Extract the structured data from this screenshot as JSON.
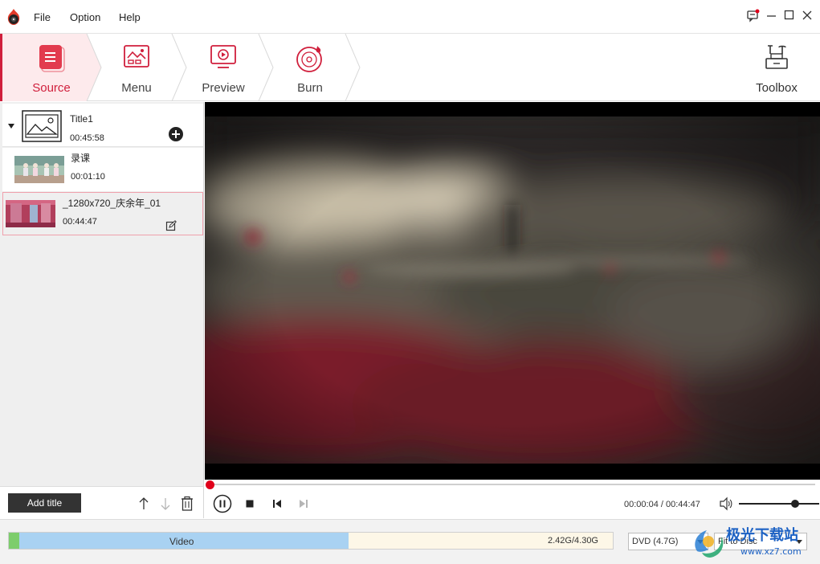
{
  "menu": {
    "file": "File",
    "option": "Option",
    "help": "Help"
  },
  "steps": [
    {
      "label": "Source",
      "active": true
    },
    {
      "label": "Menu",
      "active": false
    },
    {
      "label": "Preview",
      "active": false
    },
    {
      "label": "Burn",
      "active": false
    }
  ],
  "toolbox": {
    "label": "Toolbox"
  },
  "title": {
    "name": "Title1",
    "duration": "00:45:58"
  },
  "clips": [
    {
      "name": "录课",
      "duration": "00:01:10"
    },
    {
      "name": "_1280x720_庆余年_01",
      "duration": "00:44:47"
    }
  ],
  "left_bottom": {
    "add_title": "Add title"
  },
  "player": {
    "time": "00:00:04 / 00:44:47",
    "progress_fraction": 0.0015,
    "volume_fraction": 0.7
  },
  "status": {
    "capacity_label": "Video",
    "capacity_size": "2.42G/4.30G",
    "used_fraction": 0.563,
    "disc_type": "DVD (4.7G)",
    "fit_mode": "Fit to Disc"
  },
  "watermark": {
    "text": "极光下载站",
    "url": "www.xz7.com"
  },
  "colors": {
    "accent": "#d01f3c",
    "capacity": "#a9d2f2"
  },
  "icons": [
    "app-logo-icon",
    "source-icon",
    "menu-icon",
    "preview-icon",
    "burn-icon",
    "toolbox-icon",
    "add-icon",
    "edit-icon",
    "pause-icon",
    "stop-icon",
    "prev-icon",
    "next-icon",
    "volume-icon",
    "up-arrow-icon",
    "down-arrow-icon",
    "trash-icon",
    "feedback-icon",
    "minimize-icon",
    "maximize-icon",
    "close-icon",
    "collapse-arrow-icon"
  ]
}
